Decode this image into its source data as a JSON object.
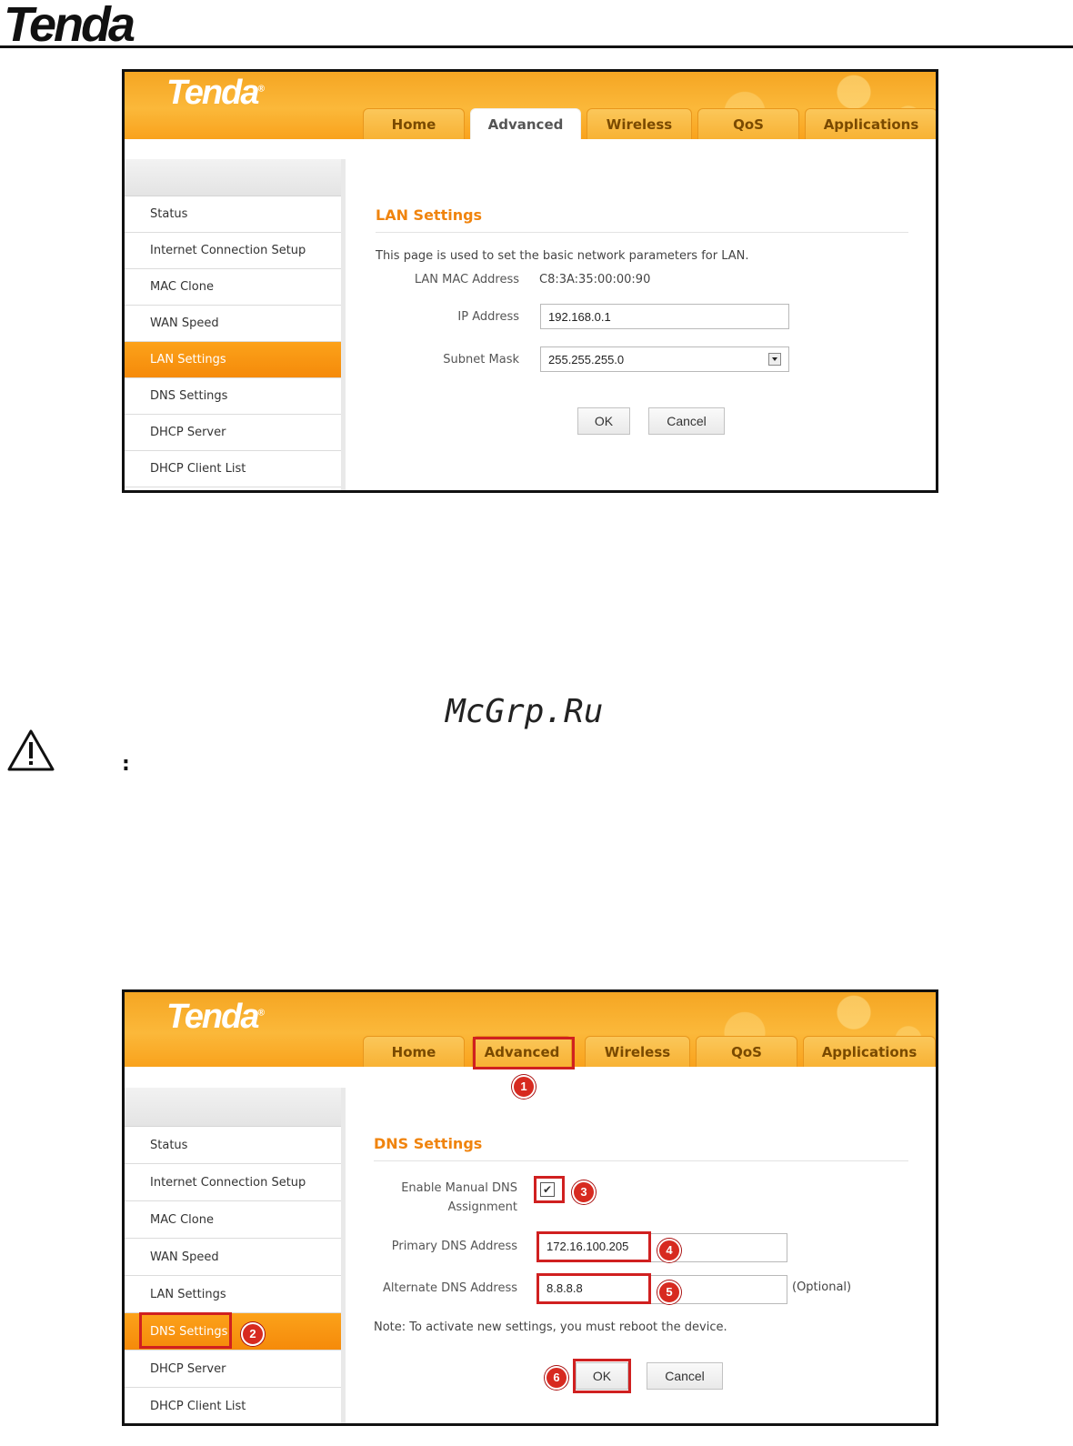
{
  "doc": {
    "logo": "Tenda",
    "watermark": "McGrp.Ru",
    "note_colon": ":"
  },
  "brand": {
    "name": "Tenda",
    "reg": "®"
  },
  "tabs": [
    "Home",
    "Advanced",
    "Wireless",
    "QoS",
    "Applications"
  ],
  "sidebar": [
    "Status",
    "Internet Connection Setup",
    "MAC Clone",
    "WAN Speed",
    "LAN Settings",
    "DNS Settings",
    "DHCP Server",
    "DHCP Client List"
  ],
  "lan": {
    "title": "LAN Settings",
    "description": "This page is used to set the basic network parameters for LAN.",
    "mac_label": "LAN MAC Address",
    "mac_value": "C8:3A:35:00:00:90",
    "ip_label": "IP Address",
    "ip_value": "192.168.0.1",
    "mask_label": "Subnet Mask",
    "mask_value": "255.255.255.0",
    "ok": "OK",
    "cancel": "Cancel"
  },
  "dns": {
    "title": "DNS Settings",
    "enable_label_1": "Enable Manual DNS",
    "enable_label_2": "Assignment",
    "checkbox_mark": "✔",
    "primary_label": "Primary DNS Address",
    "primary_value": "172.16.100.205",
    "alternate_label": "Alternate DNS Address",
    "alternate_value": "8.8.8.8",
    "optional": "(Optional)",
    "note": "Note: To activate new settings, you must reboot the device.",
    "ok": "OK",
    "cancel": "Cancel"
  },
  "callouts": [
    "1",
    "2",
    "3",
    "4",
    "5",
    "6"
  ],
  "colors": {
    "accent": "#f0840e",
    "header": "#f5a623",
    "highlight": "#d02020"
  }
}
